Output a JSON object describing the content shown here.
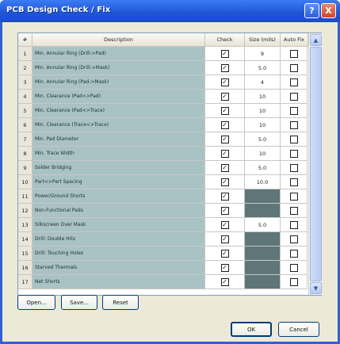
{
  "window": {
    "title": "PCB Design Check / Fix"
  },
  "title_buttons": {
    "help": "?",
    "close": "X"
  },
  "columns": {
    "num": "#",
    "description": "Description",
    "check": "Check",
    "size": "Size (mils)",
    "autofix": "Auto Fix"
  },
  "rows": [
    {
      "num": "1",
      "desc": "Min. Annular Ring (Drill->Pad)",
      "check": true,
      "size": "9",
      "size_dark": false,
      "autofix": false
    },
    {
      "num": "2",
      "desc": "Min. Annular Ring (Drill->Mask)",
      "check": true,
      "size": "5.0",
      "size_dark": false,
      "autofix": false
    },
    {
      "num": "3",
      "desc": "Min. Annular Ring (Pad->Mask)",
      "check": true,
      "size": "4",
      "size_dark": false,
      "autofix": false
    },
    {
      "num": "4",
      "desc": "Min. Clearance (Pad<>Pad)",
      "check": true,
      "size": "10",
      "size_dark": false,
      "autofix": false
    },
    {
      "num": "5",
      "desc": "Min. Clearance (Pad<>Trace)",
      "check": true,
      "size": "10",
      "size_dark": false,
      "autofix": false
    },
    {
      "num": "6",
      "desc": "Min. Clearance (Trace<>Trace)",
      "check": true,
      "size": "10",
      "size_dark": false,
      "autofix": false
    },
    {
      "num": "7",
      "desc": "Min. Pad Diameter",
      "check": true,
      "size": "5.0",
      "size_dark": false,
      "autofix": false
    },
    {
      "num": "8",
      "desc": "Min. Trace Width",
      "check": true,
      "size": "10",
      "size_dark": false,
      "autofix": false
    },
    {
      "num": "9",
      "desc": "Solder Bridging",
      "check": true,
      "size": "5.0",
      "size_dark": false,
      "autofix": false
    },
    {
      "num": "10",
      "desc": "Part<>Part Spacing",
      "check": true,
      "size": "10.0",
      "size_dark": false,
      "autofix": false
    },
    {
      "num": "11",
      "desc": "Power/Ground Shorts",
      "check": true,
      "size": "",
      "size_dark": true,
      "autofix": false
    },
    {
      "num": "12",
      "desc": "Non-Functional Pads",
      "check": true,
      "size": "",
      "size_dark": true,
      "autofix": false
    },
    {
      "num": "13",
      "desc": "Silkscreen Over Mask",
      "check": true,
      "size": "5.0",
      "size_dark": false,
      "autofix": false
    },
    {
      "num": "14",
      "desc": "Drill: Double Hits",
      "check": true,
      "size": "",
      "size_dark": true,
      "autofix": false
    },
    {
      "num": "15",
      "desc": "Drill: Touching Holes",
      "check": true,
      "size": "",
      "size_dark": true,
      "autofix": false
    },
    {
      "num": "16",
      "desc": "Starved Thermals",
      "check": true,
      "size": "",
      "size_dark": true,
      "autofix": false
    },
    {
      "num": "17",
      "desc": "Net Shorts",
      "check": true,
      "size": "",
      "size_dark": true,
      "autofix": false
    }
  ],
  "scrollbar": {
    "up": "▲",
    "down": "▼"
  },
  "buttons": {
    "open": "Open...",
    "save": "Save...",
    "reset": "Reset",
    "ok": "OK",
    "cancel": "Cancel"
  },
  "colors": {
    "title_bar": "#1f54d6",
    "desc_cell": "#a9c2c4",
    "disabled_cell": "#5e7677",
    "dialog_bg": "#ece9d8"
  }
}
